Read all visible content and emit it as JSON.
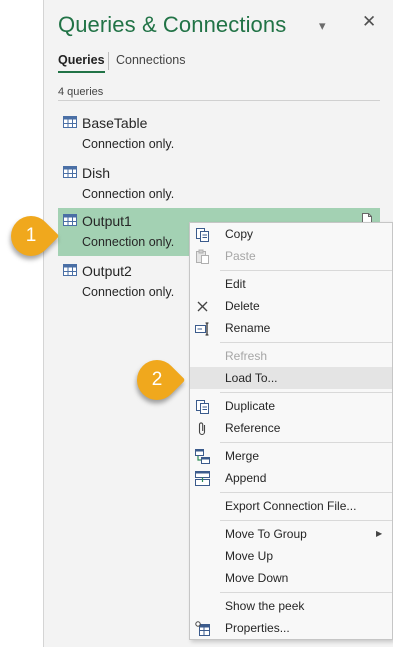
{
  "pane": {
    "title": "Queries & Connections",
    "dropdown_glyph": "▾",
    "close_glyph": "✕",
    "tabs": [
      {
        "label": "Queries",
        "active": true
      },
      {
        "label": "Connections",
        "active": false
      }
    ],
    "query_count": "4 queries"
  },
  "queries": [
    {
      "name": "BaseTable",
      "status": "Connection only.",
      "icon": "table-icon"
    },
    {
      "name": "Dish",
      "status": "Connection only.",
      "icon": "table-icon"
    },
    {
      "name": "Output1",
      "status": "Connection only.",
      "icon": "table-icon",
      "selected": true
    },
    {
      "name": "Output2",
      "status": "Connection only.",
      "icon": "table-icon"
    }
  ],
  "context_menu": {
    "items": [
      {
        "label": "Copy",
        "icon": "copy-icon",
        "enabled": true
      },
      {
        "label": "Paste",
        "icon": "paste-icon",
        "enabled": false
      },
      {
        "label": "Edit",
        "enabled": true
      },
      {
        "label": "Delete",
        "icon": "delete-icon",
        "enabled": true
      },
      {
        "label": "Rename",
        "icon": "rename-icon",
        "enabled": true
      },
      {
        "label": "Refresh",
        "enabled": false
      },
      {
        "label": "Load To...",
        "enabled": true,
        "highlighted": true
      },
      {
        "label": "Duplicate",
        "icon": "duplicate-icon",
        "enabled": true
      },
      {
        "label": "Reference",
        "icon": "reference-icon",
        "enabled": true
      },
      {
        "label": "Merge",
        "icon": "merge-icon",
        "enabled": true
      },
      {
        "label": "Append",
        "icon": "append-icon",
        "enabled": true
      },
      {
        "label": "Export Connection File...",
        "enabled": true
      },
      {
        "label": "Move To Group",
        "enabled": true,
        "submenu": true
      },
      {
        "label": "Move Up",
        "enabled": true
      },
      {
        "label": "Move Down",
        "enabled": true
      },
      {
        "label": "Show the peek",
        "enabled": true
      },
      {
        "label": "Properties...",
        "icon": "properties-icon",
        "enabled": true
      }
    ]
  },
  "callouts": [
    {
      "number": "1"
    },
    {
      "number": "2"
    }
  ],
  "colors": {
    "accent": "#217346",
    "selected_row": "#a3d1b3",
    "callout": "#f0a81d"
  }
}
